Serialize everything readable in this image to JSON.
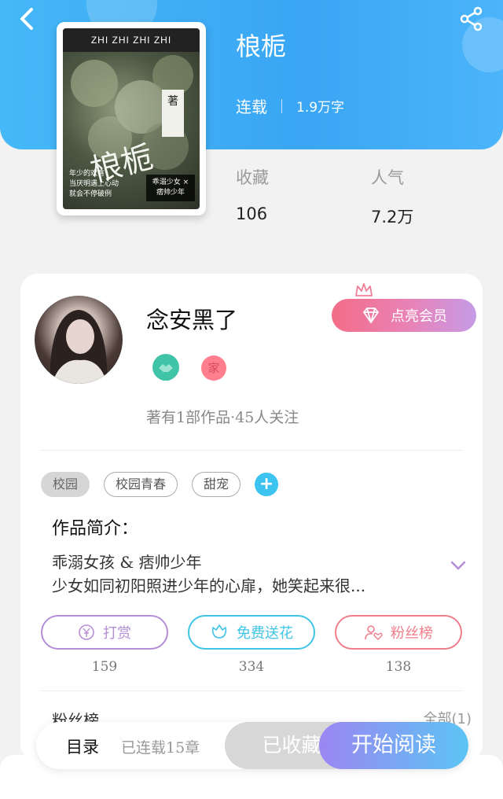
{
  "header": {
    "back_icon": "chevron-left-icon",
    "share_icon": "share-icon"
  },
  "book": {
    "title": "桹栀",
    "status": "连载",
    "word_count": "1.9万字",
    "cover": {
      "top_text": "ZHI ZHI ZHI ZHI",
      "title_text": "桹栀",
      "badge_text": "著",
      "tag_text": "乖溺少女 × 痞帅少年",
      "blurb": "年少的欢喜\n当厌明遇上心动\n就会不停破例"
    }
  },
  "stats": {
    "collect_label": "收藏",
    "collect_value": "106",
    "popularity_label": "人气",
    "popularity_value": "7.2万"
  },
  "author": {
    "name": "念安黑了",
    "member_button": "点亮会员",
    "info": "著有1部作品·45人关注",
    "badge_red_text": "家"
  },
  "tags": [
    "校园",
    "校园青春",
    "甜宠"
  ],
  "intro": {
    "title": "作品简介：",
    "line1": "乖溺女孩 & 痞帅少年",
    "line2": "少女如同初阳照进少年的心扉，她笑起来很..."
  },
  "actions": [
    {
      "label": "打赏",
      "count": "159",
      "icon": "yen-icon",
      "color": "#b58ed6"
    },
    {
      "label": "免费送花",
      "count": "334",
      "icon": "flower-icon",
      "color": "#3fc4e6"
    },
    {
      "label": "粉丝榜",
      "count": "138",
      "icon": "user-heart-icon",
      "color": "#f07d8a"
    }
  ],
  "fans_section": {
    "title": "粉丝榜",
    "more": "全部(1)"
  },
  "bottom_bar": {
    "toc": "目录",
    "chapters": "已连载15章",
    "collected": "已收藏",
    "read": "开始阅读"
  }
}
